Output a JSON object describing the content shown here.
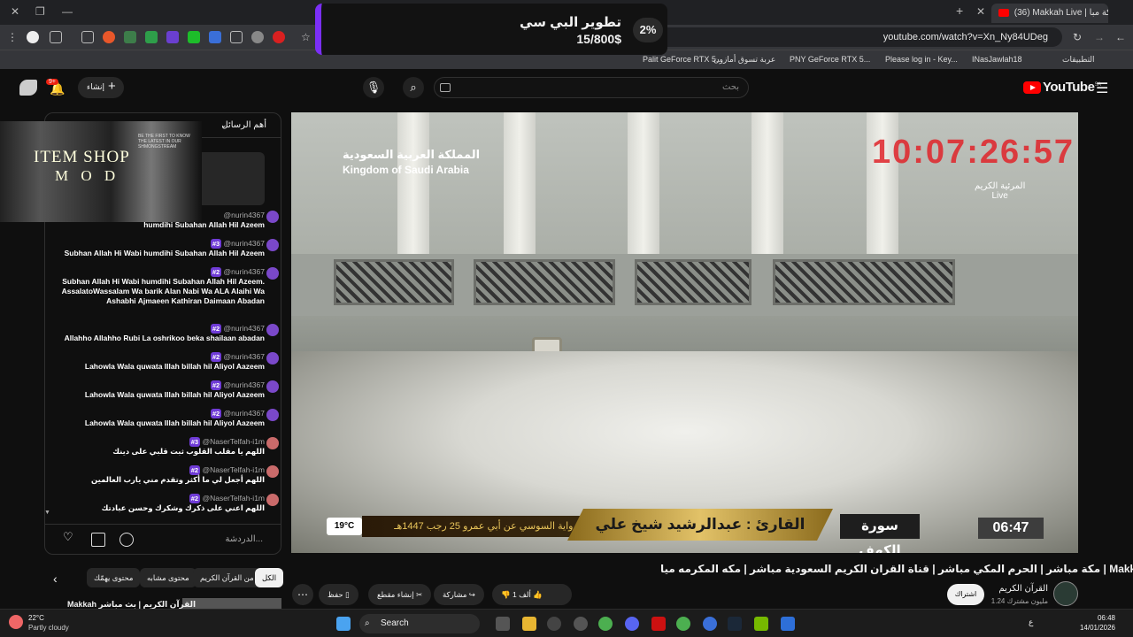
{
  "browser": {
    "tab_count": "(36)",
    "tab_title": "Makkah Live | مكة مبا",
    "url": "youtube.com/watch?v=Xn_Ny84UDeg"
  },
  "bookmarks": [
    "Palit GeForce RTX 5...",
    "عربة تسوق أمازون",
    "PNY GeForce RTX 5...",
    "Please log in - Key...",
    "INasJawlah18",
    "التطبيقات"
  ],
  "toast": {
    "percent": "2%",
    "title": "تطوير البي سي",
    "subtitle": "15/800$"
  },
  "yt_header": {
    "search_placeholder": "بحث",
    "create_label": "إنشاء",
    "notification_count": "9+",
    "logo_text": "YouTube",
    "region": "SA"
  },
  "chat": {
    "header_label": "أهم الرسائل",
    "input_placeholder": "الدردشة...",
    "messages": [
      {
        "author": "@nurin4367",
        "badge": "",
        "text": "humdihi Subahan Allah Hil Azeem"
      },
      {
        "author": "@nurin4367",
        "badge": "#3",
        "text": "Subhan Allah Hi Wabi humdihi Subahan Allah Hil Azeem"
      },
      {
        "author": "@nurin4367",
        "badge": "#2",
        "text": "Subhan Allah Hi Wabi humdihi Subahan Allah Hil Azeem. AssalatoWassalam Wa barik Alan Nabi Wa ALA Alaihi Wa Ashabhi Ajmaeen Kathiran Daimaan Abadan"
      },
      {
        "author": "@nurin4367",
        "badge": "#2",
        "text": "Allahho Allahho Rubi La oshrikoo beka shailaan abadan"
      },
      {
        "author": "@nurin4367",
        "badge": "#2",
        "text": "Lahowla Wala quwata Illah billah hil Aliyol Aazeem"
      },
      {
        "author": "@nurin4367",
        "badge": "#2",
        "text": "Lahowla Wala quwata Illah billah hil Aliyol Aazeem"
      },
      {
        "author": "@nurin4367",
        "badge": "#2",
        "text": "Lahowla Wala quwata Illah billah hil Aliyol Aazeem"
      },
      {
        "author": "@NaserTelfah-i1m",
        "badge": "#3",
        "text": "اللهم يا مقلب القلوب ثبت قلبي على دينك"
      },
      {
        "author": "@NaserTelfah-i1m",
        "badge": "#2",
        "text": "اللهم أجعل لي ما أكثر وتقدم مني يارب العالمين"
      },
      {
        "author": "@NaserTelfah-i1m",
        "badge": "#2",
        "text": "اللهم اعني على ذكرك وشكرك وحسن عبادتك"
      }
    ]
  },
  "overlay": {
    "line1": "ITEM SHOP",
    "line2": "M O D",
    "small": "BE THE FIRST TO KNOW THE LATEST IN OUR SHMONGSTREAM"
  },
  "video": {
    "ksa_ar": "المملكة العربية السعودية",
    "ksa_en": "Kingdom of Saudi Arabia",
    "clock": "10:07:26:57",
    "channel_ov": "المرئية الكريم",
    "live": "Live",
    "temp": "19°C",
    "date": "25 رجب 1447هـ",
    "riwaya": "رواية السوسي عن أبي عمرو",
    "reader": "القارئ : عبدالرشيد شيخ علي",
    "surah": "سورة الكهف",
    "time": "06:47"
  },
  "video_title": "مكة مباشر | الحرم المكي مباشر | قناة القران الكريم السعودية مباشر | مكه المكرمه ميا | Makkah Live",
  "channel": {
    "name": "القرآن الكريم",
    "subs": "1.24 مليون مشترك",
    "subscribe": "اشتراك"
  },
  "actions": {
    "like_count": "1 ألف",
    "share": "مشاركة",
    "clip": "إنشاء مقطع",
    "save": "حفظ"
  },
  "chips": [
    "الكل",
    "من القرآن الكريم",
    "محتوى مشابه",
    "محتوى يهمّك"
  ],
  "upnext": "Makkah القرآن الكريم | بث مباشر",
  "taskbar": {
    "temp": "22°C",
    "weather": "Partly cloudy",
    "search": "Search",
    "time": "06:48",
    "date": "14/01/2026",
    "lang": "ع"
  }
}
